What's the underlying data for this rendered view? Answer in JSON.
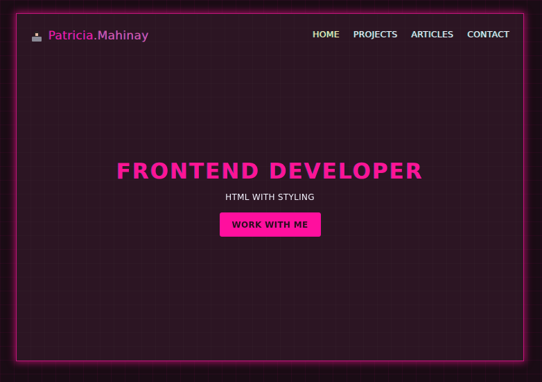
{
  "brand": {
    "first": "Patricia",
    "second": ".Mahinay",
    "icon": "developer-avatar-icon"
  },
  "nav": [
    {
      "label": "HOME"
    },
    {
      "label": "PROJECTS"
    },
    {
      "label": "ARTICLES"
    },
    {
      "label": "CONTACT"
    }
  ],
  "hero": {
    "title": "FRONTEND DEVELOPER",
    "subtitle": "HTML WITH STYLING",
    "cta": "WORK WITH ME"
  },
  "colors": {
    "accent": "#ff1493",
    "panel": "#2c1523",
    "background": "#1a0c15"
  }
}
